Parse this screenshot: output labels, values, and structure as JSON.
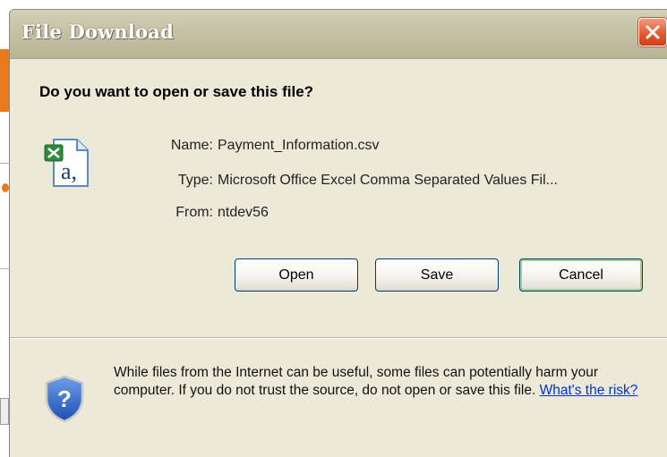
{
  "dialog": {
    "title": "File Download",
    "question": "Do you want to open or save this file?",
    "file": {
      "name_label": "Name:",
      "name_value": "Payment_Information.csv",
      "type_label": "Type:",
      "type_value": "Microsoft Office Excel Comma Separated Values Fil...",
      "from_label": "From:",
      "from_value": "ntdev56",
      "icon": "excel-csv-file-icon"
    },
    "buttons": {
      "open": "Open",
      "save": "Save",
      "cancel": "Cancel"
    },
    "warning": {
      "text": "While files from the Internet can be useful, some files can potentially harm your computer. If you do not trust the source, do not open or save this file.",
      "link": "What's the risk?",
      "icon": "security-shield-question-icon"
    },
    "colors": {
      "titlebar": "#c6c2a6",
      "dialog_bg": "#ece9d8",
      "close_button": "#e0562c",
      "link": "#0033cc"
    }
  }
}
